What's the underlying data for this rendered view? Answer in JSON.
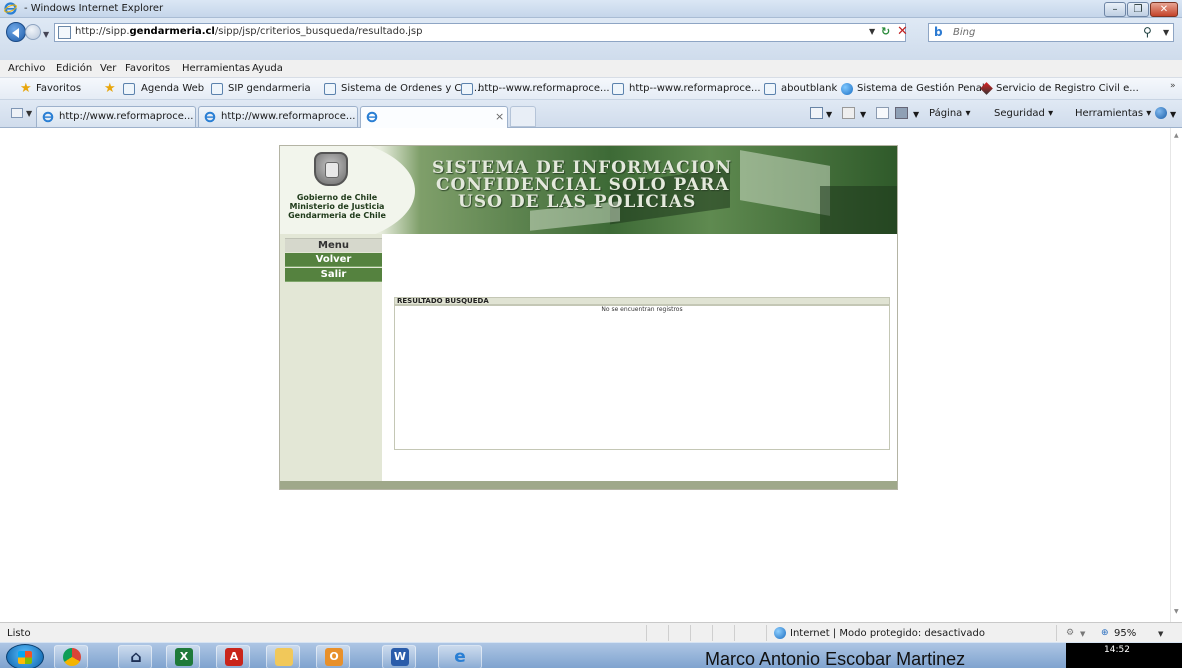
{
  "window": {
    "title": "- Windows Internet Explorer"
  },
  "address": {
    "url_prefix": "http://sipp.",
    "url_domain": "gendarmeria.cl",
    "url_suffix": "/sipp/jsp/criterios_busqueda/resultado.jsp"
  },
  "search": {
    "placeholder": "Bing"
  },
  "menu": [
    "Archivo",
    "Edición",
    "Ver",
    "Favoritos",
    "Herramientas",
    "Ayuda"
  ],
  "favorites": {
    "label": "Favoritos",
    "items": [
      "Agenda Web",
      "SIP gendarmeria",
      "Sistema de Ordenes y Con...",
      "http--www.reformaproce...",
      "http--www.reformaproce...",
      "aboutblank",
      "Sistema de Gestión Penal",
      "Servicio de Registro Civil e..."
    ]
  },
  "tabs": [
    "http://www.reformaproce...",
    "http://www.reformaproce...",
    ""
  ],
  "commandbar": {
    "page": "Página",
    "safety": "Seguridad",
    "tools": "Herramientas"
  },
  "site": {
    "gov_lines": [
      "Gobierno de Chile",
      "Ministerio de Justicia",
      "Gendarmeria de Chile"
    ],
    "title_lines": [
      "SISTEMA DE INFORMACION",
      "CONFIDENCIAL SOLO PARA",
      "USO DE LAS POLICIAS"
    ],
    "menu_label": "Menu",
    "menu_items": [
      "Volver",
      "Salir"
    ],
    "results_title": "RESULTADO BUSQUEDA",
    "results_message": "No se encuentran registros"
  },
  "status": {
    "ready": "Listo",
    "zone": "Internet | Modo protegido: desactivado",
    "zoom": "95%"
  },
  "taskbar": {
    "user": "Marco Antonio Escobar Martinez",
    "time": "14:52"
  },
  "colors": {
    "menu_green": "#55823f",
    "sidebar_bg": "#e3e7d6",
    "banner_green": "#3d6a36"
  }
}
